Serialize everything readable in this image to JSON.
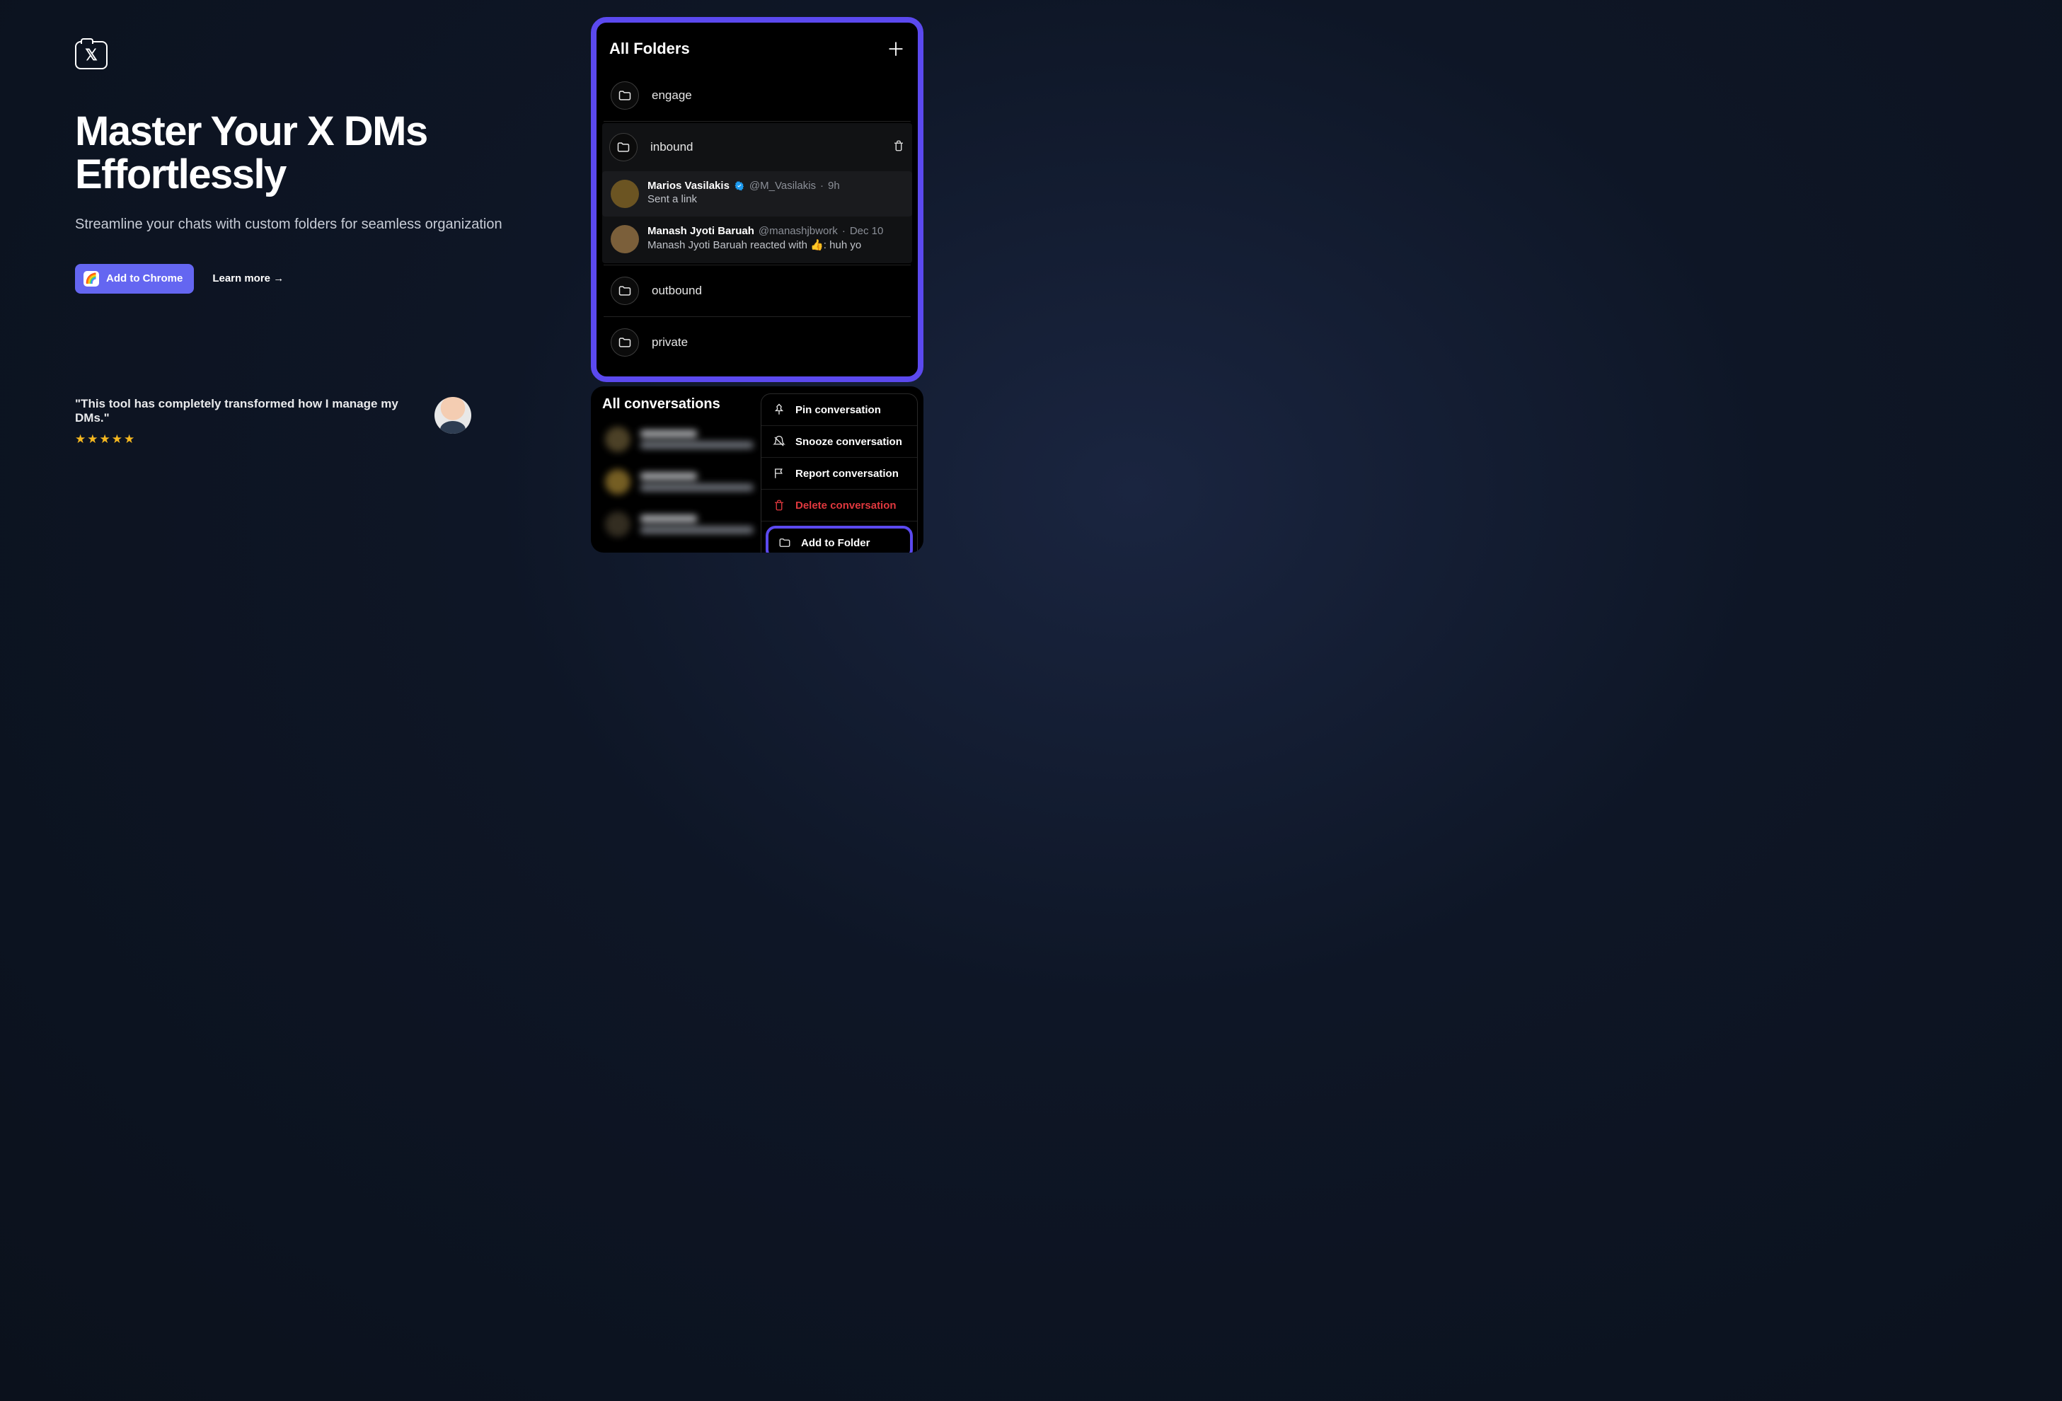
{
  "hero": {
    "heading_line1": "Master Your X DMs",
    "heading_line2": "Effortlessly",
    "subhead": "Streamline your chats with custom folders for seamless organization",
    "cta_primary": "Add to Chrome",
    "cta_secondary": "Learn more →"
  },
  "testimonial": {
    "quote": "\"This tool has completely transformed how I manage my DMs.\"",
    "stars": "★★★★★"
  },
  "folders": {
    "title": "All Folders",
    "items": [
      {
        "name": "engage"
      },
      {
        "name": "inbound"
      },
      {
        "name": "outbound"
      },
      {
        "name": "private"
      }
    ]
  },
  "inbound_dms": [
    {
      "name": "Marios Vasilakis",
      "verified": true,
      "handle": "@M_Vasilakis",
      "time": "9h",
      "preview": "Sent a link"
    },
    {
      "name": "Manash Jyoti Baruah",
      "verified": false,
      "handle": "@manashjbwork",
      "time": "Dec 10",
      "preview": "Manash Jyoti Baruah reacted with 👍: huh yo"
    }
  ],
  "conversations": {
    "title": "All conversations"
  },
  "context_menu": {
    "pin": "Pin conversation",
    "snooze": "Snooze conversation",
    "report": "Report conversation",
    "delete": "Delete conversation",
    "add_folder": "Add to Folder"
  }
}
